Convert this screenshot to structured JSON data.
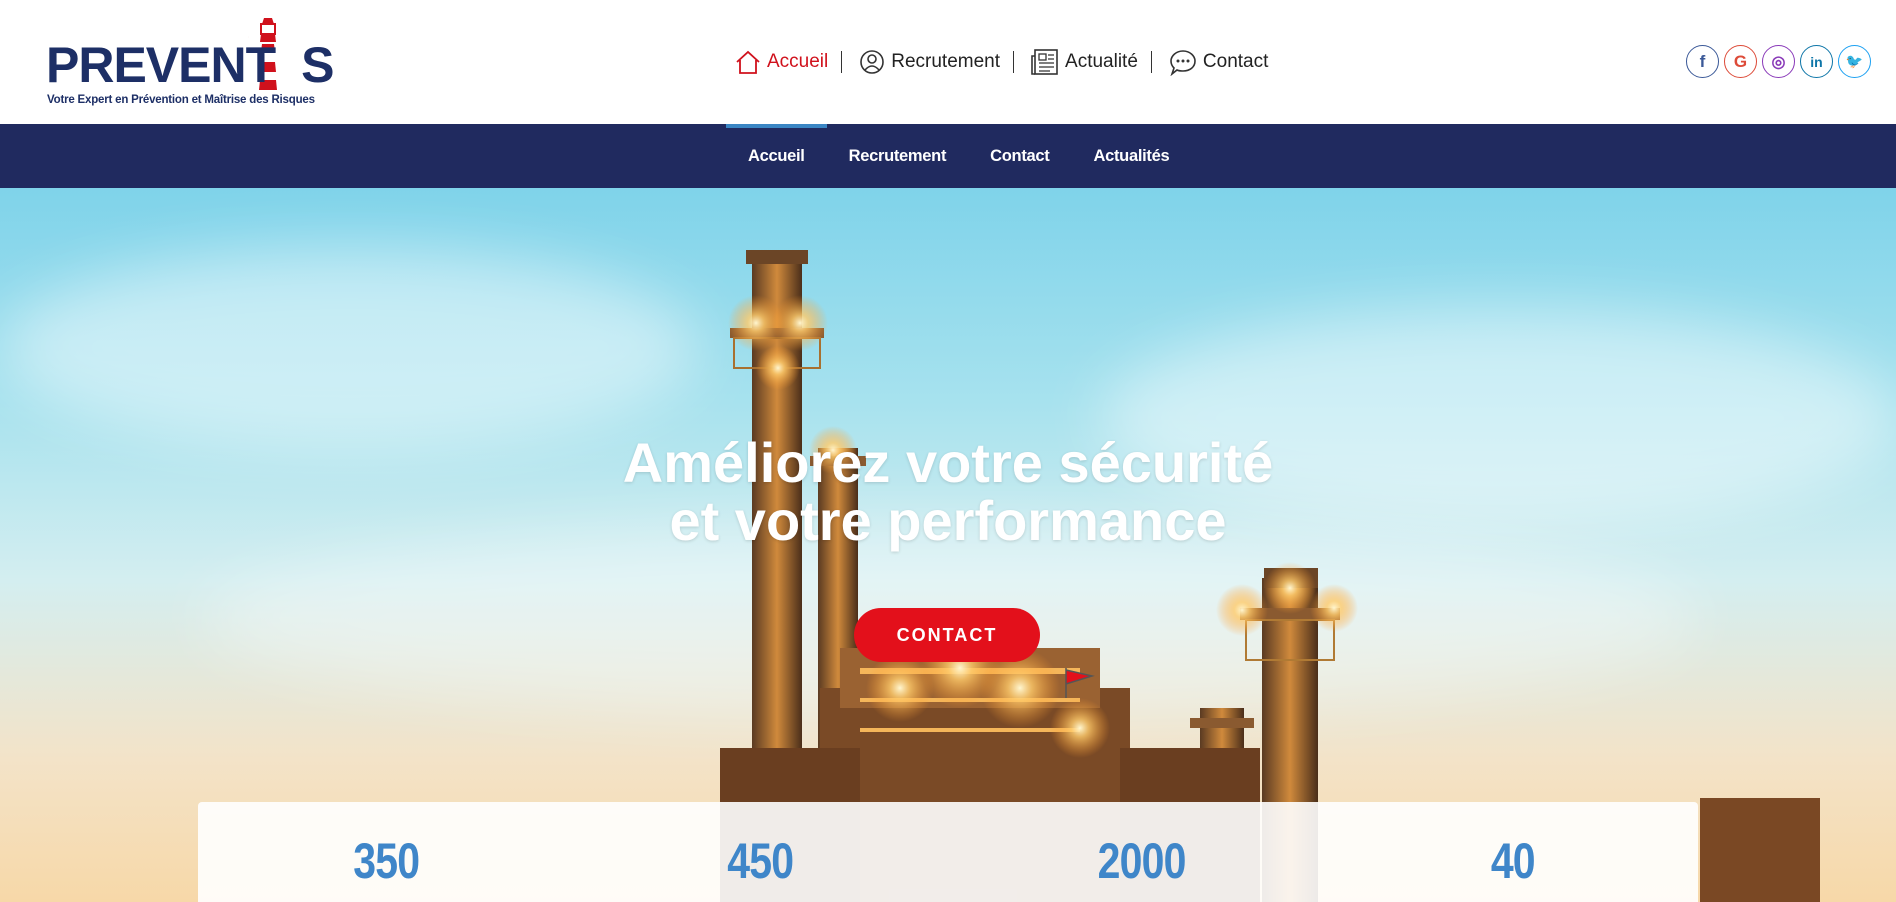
{
  "brand": {
    "name": "PREVENTIS",
    "name_part1": "PREVENT",
    "name_part2": "S",
    "tagline": "Votre Expert en Prévention et Maîtrise des Risques",
    "primary_color": "#1d2f66",
    "accent_color": "#d0111c"
  },
  "top_nav": [
    {
      "label": "Accueil",
      "icon": "home-icon",
      "active": true
    },
    {
      "label": "Recrutement",
      "icon": "user-icon",
      "active": false
    },
    {
      "label": "Actualité",
      "icon": "newspaper-icon",
      "active": false
    },
    {
      "label": "Contact",
      "icon": "chat-icon",
      "active": false
    }
  ],
  "socials": [
    {
      "name": "facebook",
      "glyph": "f",
      "color": "#3b5998"
    },
    {
      "name": "google",
      "glyph": "G",
      "color": "#dd4b39"
    },
    {
      "name": "instagram",
      "glyph": "◎",
      "color": "#8a3ab9"
    },
    {
      "name": "linkedin",
      "glyph": "in",
      "color": "#0e76a8"
    },
    {
      "name": "twitter",
      "glyph": "🐦",
      "color": "#1da1f2"
    }
  ],
  "main_nav": [
    {
      "label": "Accueil",
      "active": true
    },
    {
      "label": "Recrutement",
      "active": false
    },
    {
      "label": "Contact",
      "active": false
    },
    {
      "label": "Actualités",
      "active": false
    }
  ],
  "hero": {
    "title_line1": "Améliorez votre sécurité",
    "title_line2": "et votre performance",
    "cta_label": "CONTACT",
    "cta_color": "#e3101b"
  },
  "stats": [
    "350",
    "450",
    "2000",
    "40"
  ],
  "colors": {
    "nav_bar": "#202a5f",
    "stat_number": "#3f86c9"
  }
}
